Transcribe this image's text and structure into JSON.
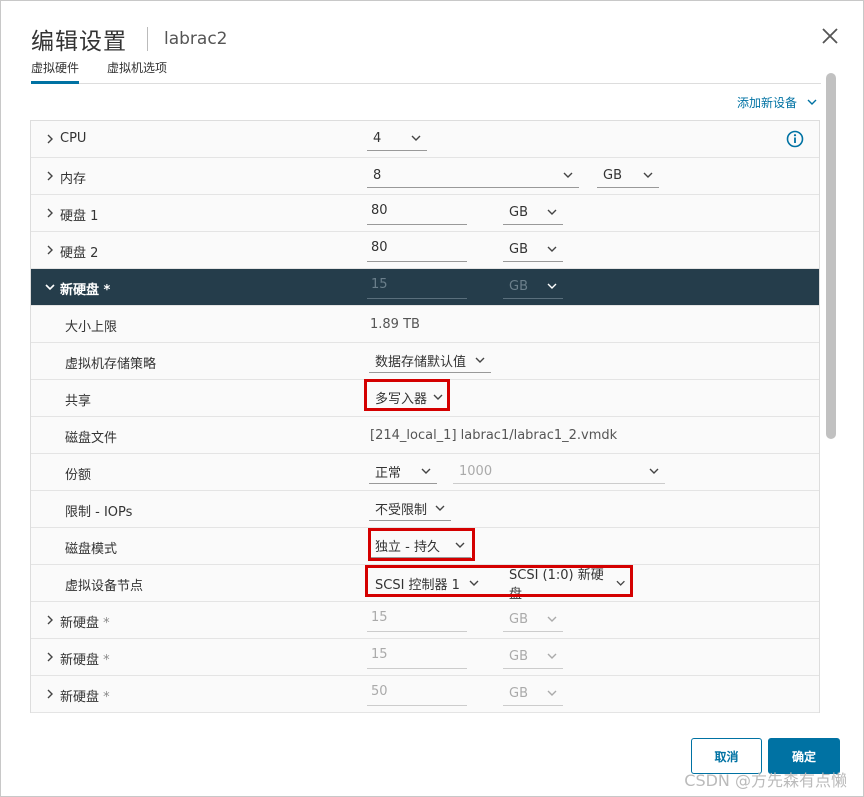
{
  "dialog": {
    "title": "编辑设置",
    "subtitle": "labrac2"
  },
  "tabs": [
    {
      "label": "虚拟硬件"
    },
    {
      "label": "虚拟机选项"
    }
  ],
  "add_device": {
    "label": "添加新设备"
  },
  "rows": {
    "cpu": {
      "label": "CPU",
      "value": "4"
    },
    "memory": {
      "label": "内存",
      "value": "8",
      "unit": "GB"
    },
    "disk1": {
      "label": "硬盘 1",
      "value": "80",
      "unit": "GB"
    },
    "disk2": {
      "label": "硬盘 2",
      "value": "80",
      "unit": "GB"
    },
    "new_disk": {
      "label": "新硬盘",
      "star": "*",
      "value": "15",
      "unit": "GB"
    },
    "max_size": {
      "label": "大小上限",
      "value": "1.89 TB"
    },
    "storage_policy": {
      "label": "虚拟机存储策略",
      "value": "数据存储默认值"
    },
    "sharing": {
      "label": "共享",
      "value": "多写入器"
    },
    "disk_file": {
      "label": "磁盘文件",
      "value": "[214_local_1] labrac1/labrac1_2.vmdk"
    },
    "shares": {
      "label": "份额",
      "value": "正常",
      "amount": "1000"
    },
    "limit_iops": {
      "label": "限制 - IOPs",
      "value": "不受限制"
    },
    "disk_mode": {
      "label": "磁盘模式",
      "value": "独立 - 持久"
    },
    "device_node": {
      "label": "虚拟设备节点",
      "controller": "SCSI 控制器 1",
      "node": "SCSI (1:0) 新硬盘"
    },
    "new_disk_2": {
      "label": "新硬盘",
      "star": "*",
      "value": "15",
      "unit": "GB"
    },
    "new_disk_3": {
      "label": "新硬盘",
      "star": "*",
      "value": "15",
      "unit": "GB"
    },
    "new_disk_4": {
      "label": "新硬盘",
      "star": "*",
      "value": "50",
      "unit": "GB"
    }
  },
  "buttons": {
    "cancel": "取消",
    "ok": "确定"
  },
  "watermark": "CSDN @方先森有点懒",
  "colors": {
    "accent": "#0072a3",
    "selected_row": "#253d4b",
    "highlight_box": "#d40000"
  }
}
